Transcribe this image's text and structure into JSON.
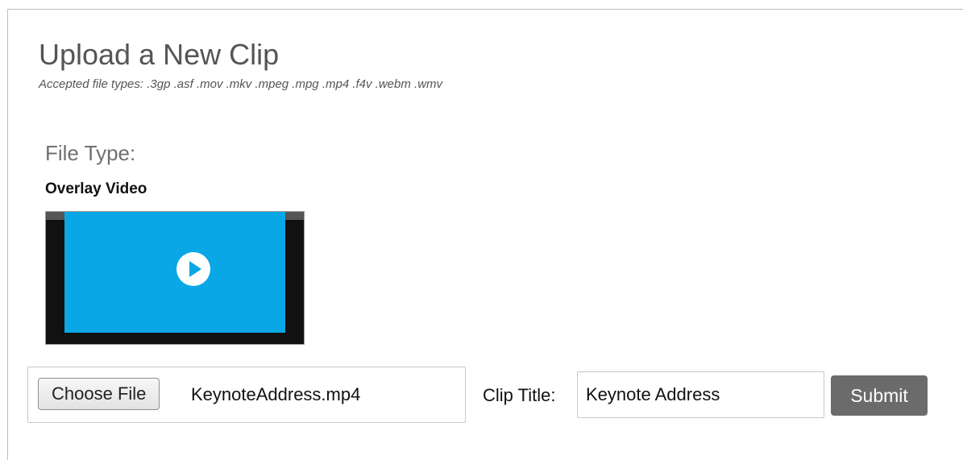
{
  "upload": {
    "title": "Upload a New Clip",
    "accepted_types": "Accepted file types: .3gp .asf .mov .mkv .mpeg .mpg .mp4 .f4v .webm .wmv"
  },
  "file_type": {
    "label": "File Type:",
    "selected_name": "Overlay Video",
    "thumbnail_icon": "play-icon",
    "thumbnail_color": "#0aa7e6"
  },
  "form": {
    "choose_file_label": "Choose File",
    "chosen_file_name": "KeynoteAddress.mp4",
    "clip_title_label": "Clip Title:",
    "clip_title_value": "Keynote Address",
    "submit_label": "Submit"
  },
  "colors": {
    "submit_bg": "#6b6b6b",
    "accent_blue": "#0aa7e6"
  }
}
